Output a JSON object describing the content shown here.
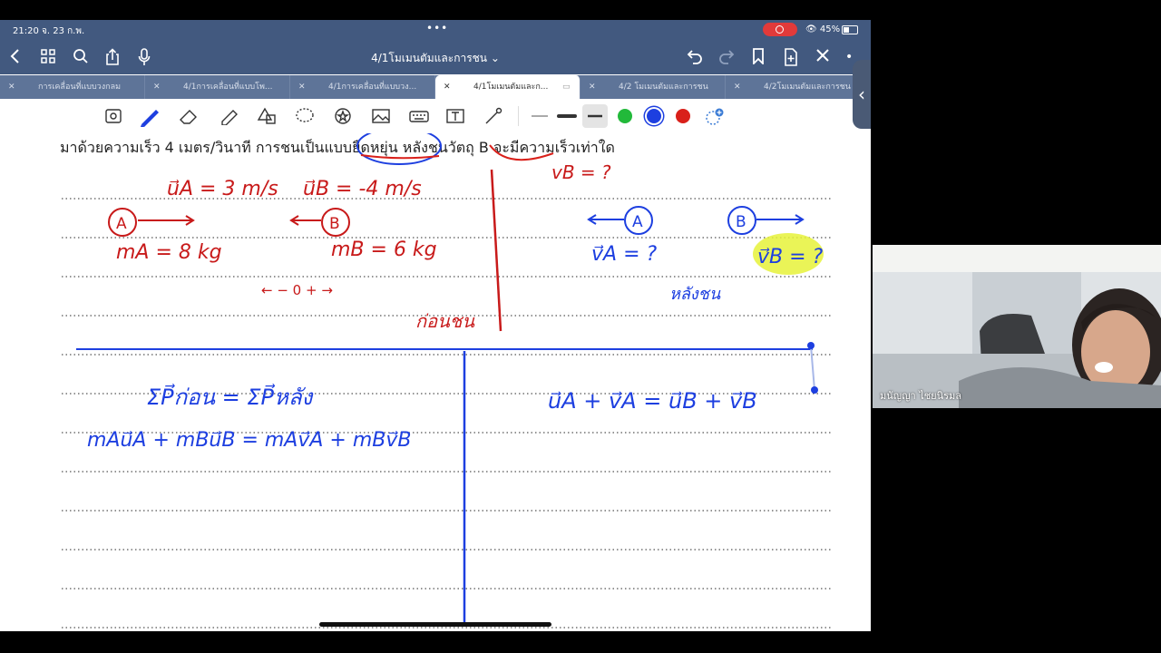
{
  "status_bar": {
    "time": "21:20  จ. 23 ก.พ.",
    "dots": "•••",
    "battery": "45%"
  },
  "nav": {
    "title": "4/1โมเมนตัมและการชน ⌄",
    "icons": [
      "back-icon",
      "grid-icon",
      "search-icon",
      "share-icon",
      "mic-icon",
      "undo-icon",
      "redo-icon",
      "bookmark-icon",
      "add-page-icon",
      "close-icon",
      "more-icon"
    ]
  },
  "tabs": [
    {
      "label": "การเคลื่อนที่แบบวงกลม",
      "active": false
    },
    {
      "label": "4/1การเคลื่อนที่แบบโพ...",
      "active": false
    },
    {
      "label": "4/1การเคลื่อนที่แบบวง...",
      "active": false
    },
    {
      "label": "4/1โมเมนตัมและก...",
      "active": true
    },
    {
      "label": "4/2 โมเมนตัมและการชน",
      "active": false
    },
    {
      "label": "4/2โมเมนตัมและการชน",
      "active": false
    }
  ],
  "tool_colors": {
    "green": "#22b93a",
    "blue": "#1d3fe0",
    "red": "#d9201a"
  },
  "note": {
    "problem_line": "มาด้วยความเร็ว 4 เมตร/วินาที การชนเป็นแบบยืดหยุ่น หลังชนวัตถุ B จะมีความเร็วเท่าใด",
    "hw_uA": "u⃗A = 3 m/s",
    "hw_uB": "u⃗B = -4 m/s",
    "hw_vB_top": "vB = ?",
    "hw_ball_A": "A",
    "hw_ball_B": "B",
    "hw_mA": "mA = 8 kg",
    "hw_mB": "mB = 6 kg",
    "hw_sign": "← − 0 + →",
    "hw_before": "ก่อนชน",
    "hw_vA": "v⃗A = ?",
    "hw_vB": "v⃗B = ?",
    "hw_after": "หลังชน",
    "hw_sum_p": "ΣP⃗ก่อน = ΣP⃗หลัง",
    "hw_momentum": "mAu⃗A + mBu⃗B = mAv⃗A + mBv⃗B",
    "hw_elastic": "u⃗A + v⃗A = u⃗B + v⃗B"
  },
  "video": {
    "participant_name": "มนัญญา ไชยนิรมล"
  }
}
